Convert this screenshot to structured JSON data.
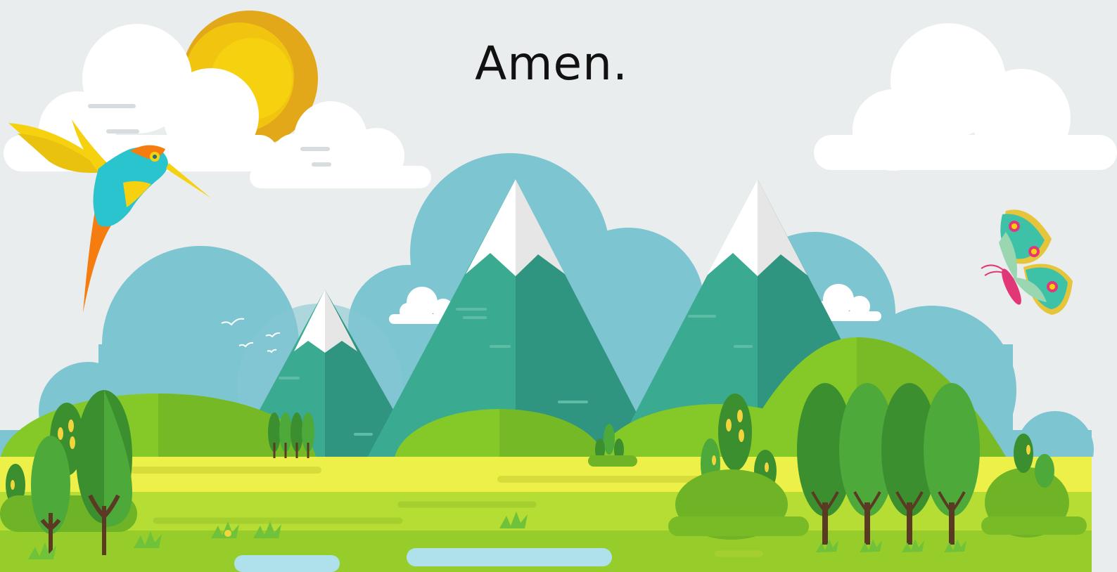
{
  "slide": {
    "title": "Amen."
  },
  "colors": {
    "sky": "#e9edee",
    "sun_outer": "#e2a81a",
    "sun_inner": "#f6d10f",
    "backdrop": "#7cc5d1",
    "mountain_light": "#3aaa90",
    "mountain_dark": "#2f9480",
    "snow": "#ffffff",
    "hill_light": "#84c928",
    "hill_dark": "#6fb327",
    "field_yellow": "#eef04a",
    "field_green": "#b5dd33",
    "ground": "#97cd2a",
    "tree_dark": "#3b8f2e",
    "tree_light": "#4ca93a",
    "trunk": "#5a3a22",
    "water": "#aee1ec"
  }
}
